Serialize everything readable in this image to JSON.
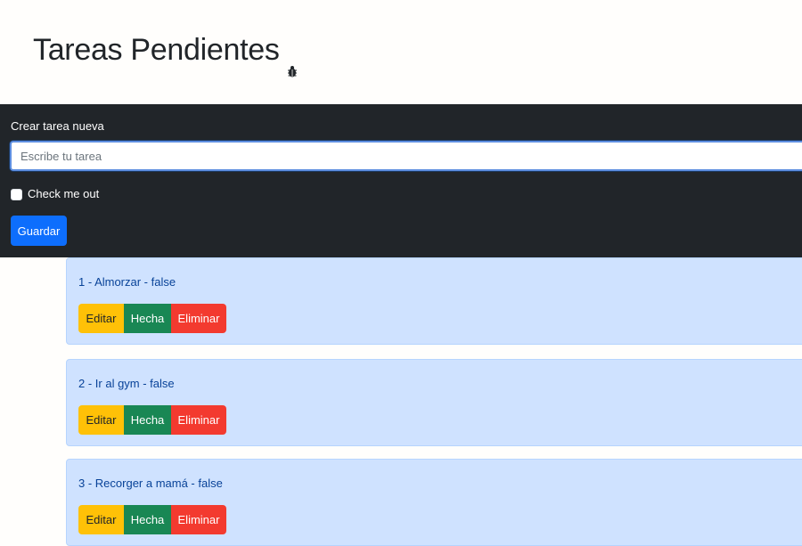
{
  "header": {
    "title": "Tareas Pendientes",
    "icon": "bug-icon"
  },
  "form": {
    "label": "Crear tarea nueva",
    "input_value": "",
    "input_placeholder": "Escribe tu tarea",
    "checkbox_label": "Check me out",
    "checkbox_checked": false,
    "save_label": "Guardar"
  },
  "colors": {
    "form_panel": "#212529",
    "primary": "#0d6efd",
    "card_bg": "#cfe2ff",
    "card_text": "#084298",
    "edit": "#ffc107",
    "done": "#198754",
    "delete": "#f33a2f"
  },
  "tasks": [
    {
      "text": "1 - Almorzar - false",
      "edit_label": "Editar",
      "done_label": "Hecha",
      "delete_label": "Eliminar"
    },
    {
      "text": "2 - Ir al gym - false",
      "edit_label": "Editar",
      "done_label": "Hecha",
      "delete_label": "Eliminar"
    },
    {
      "text": "3 - Recorger a mamá - false",
      "edit_label": "Editar",
      "done_label": "Hecha",
      "delete_label": "Eliminar"
    }
  ]
}
